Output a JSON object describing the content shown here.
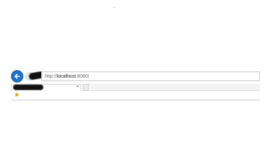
{
  "browser": {
    "address": {
      "prefix": "http://",
      "host": "localhost",
      "suffix": ":8080/"
    },
    "tab": {
      "close_glyph": "×"
    },
    "icons": {
      "back": "back-arrow-icon",
      "forward": "forward-icon",
      "favorites": "favorites-star-icon"
    },
    "colors": {
      "back_button": "#1f73c9",
      "favorites_star": "#d7a700"
    }
  }
}
